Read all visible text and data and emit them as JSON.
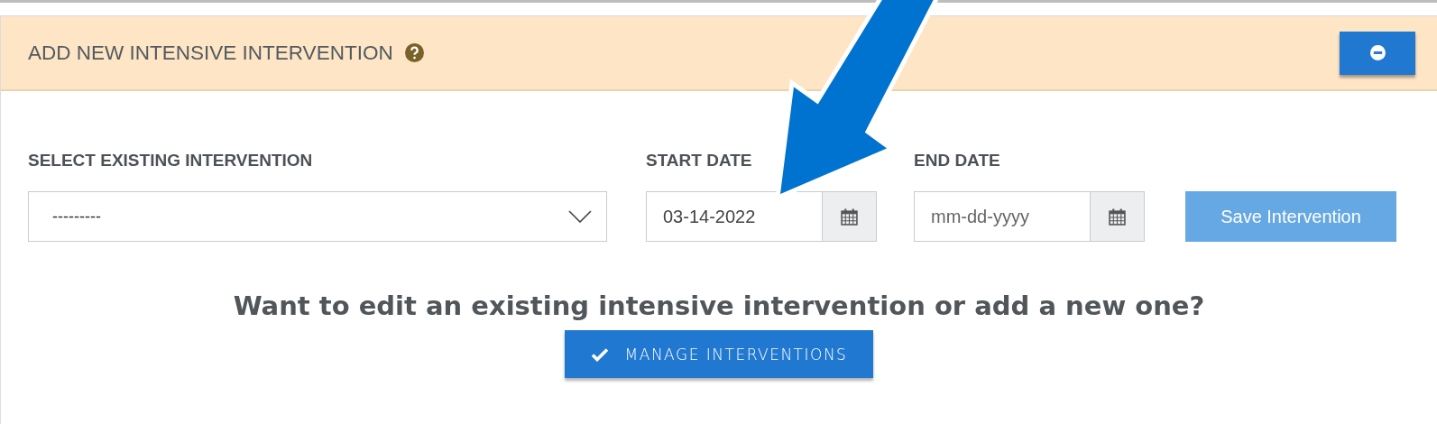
{
  "panel": {
    "title": "ADD NEW INTENSIVE INTERVENTION"
  },
  "form": {
    "fields": [
      {
        "kind": "select",
        "label": "SELECT EXISTING INTERVENTION",
        "value": "---------"
      },
      {
        "kind": "date",
        "label": "START DATE",
        "value": "03-14-2022"
      },
      {
        "kind": "date",
        "label": "END DATE",
        "placeholder": "mm-dd-yyyy"
      }
    ],
    "save_button": {
      "label": "Save Intervention",
      "disabled": true
    }
  },
  "prompt": {
    "text": "Want to edit an existing intensive intervention or add a new one?",
    "button": "MANAGE INTERVENTIONS"
  }
}
